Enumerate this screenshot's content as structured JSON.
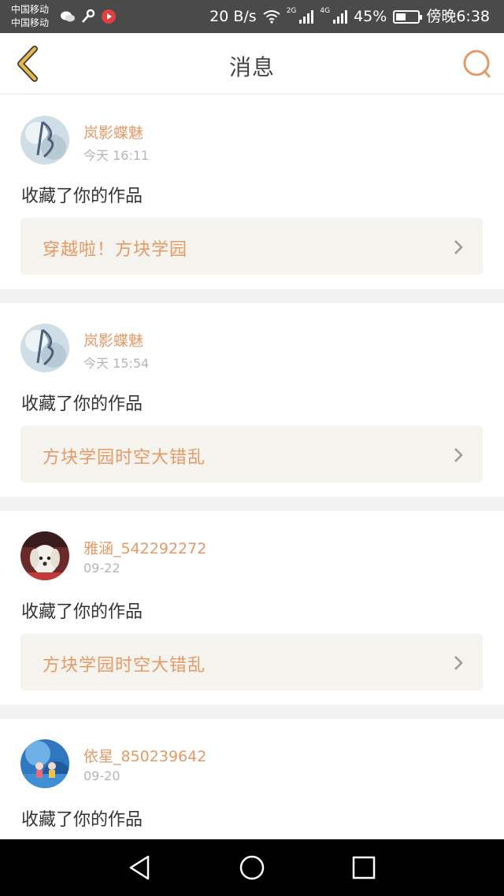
{
  "status_bar": {
    "carrier1": "中国移动",
    "carrier2": "中国移动",
    "net_speed": "20 B/s",
    "net_2g": "2G",
    "net_4g": "4G",
    "battery": "45%",
    "time": "傍晚6:38"
  },
  "header": {
    "title": "消息",
    "back_icon": "chevron-left-icon",
    "chat_icon": "chat-bubble-icon"
  },
  "colors": {
    "accent": "#e49a67",
    "back_arrow": "#e8b84a",
    "card_bg": "#f5f3ee",
    "separator": "#f2f2f2"
  },
  "messages": [
    {
      "user": "岚影蝶魅",
      "time": "今天 16:11",
      "action": "收藏了你的作品",
      "work": "穿越啦！方块学园",
      "avatar": "butterfly"
    },
    {
      "user": "岚影蝶魅",
      "time": "今天 15:54",
      "action": "收藏了你的作品",
      "work": "方块学园时空大错乱",
      "avatar": "butterfly"
    },
    {
      "user": "雅涵_542292272",
      "time": "09-22",
      "action": "收藏了你的作品",
      "work": "方块学园时空大错乱",
      "avatar": "dog"
    },
    {
      "user": "依星_850239642",
      "time": "09-20",
      "action": "收藏了你的作品",
      "work": "",
      "avatar": "sky"
    }
  ]
}
